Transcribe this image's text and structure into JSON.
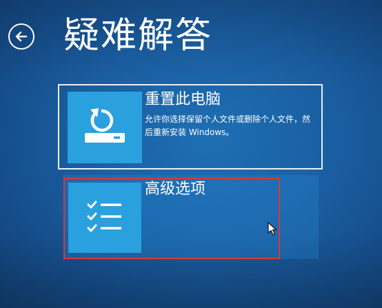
{
  "header": {
    "back_icon": "back-arrow-circle-icon",
    "title": "疑难解答"
  },
  "options": [
    {
      "title": "重置此电脑",
      "description": "允许你选择保留个人文件或删除个人文件，然后重新安装 Windows。",
      "icon": "reset-pc-icon",
      "state": "outlined"
    },
    {
      "title": "高级选项",
      "description": "",
      "icon": "checklist-icon",
      "state": "hover-highlighted"
    }
  ],
  "colors": {
    "background": "#1a5da0",
    "tile_icon_bg": "#2aa0de",
    "text": "#ffffff",
    "highlight_outline": "#d63a3a"
  }
}
